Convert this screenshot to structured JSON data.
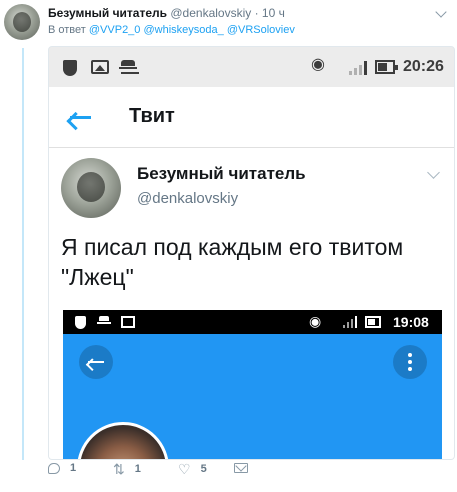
{
  "tweet": {
    "author_name": "Безумный читатель",
    "author_handle": "@denkalovskiy",
    "time": "· 10 ч",
    "reply_prefix": "В ответ",
    "mention_1": "@VVP2_0",
    "mention_2": "@whiskeysoda_",
    "mention_3": "@VRSoloviev"
  },
  "screenshot": {
    "status_time": "20:26",
    "appbar_title": "Твит",
    "author_name": "Безумный читатель",
    "author_handle": "@denkalovskiy",
    "body_text": "Я писал под каждым его твитом \"Лжец\"",
    "inner_status_time": "19:08",
    "accent_color": "#2196f3"
  },
  "actions": {
    "reply_count": "1",
    "retweet_count": "1",
    "like_count": "5"
  },
  "icons": [
    "caret-down-icon",
    "reply-icon",
    "retweet-icon",
    "like-icon",
    "direct-message-icon",
    "shield-icon",
    "image-icon",
    "incognito-icon",
    "wifi-icon",
    "signal-icon",
    "battery-icon",
    "back-arrow-icon",
    "more-vertical-icon"
  ]
}
